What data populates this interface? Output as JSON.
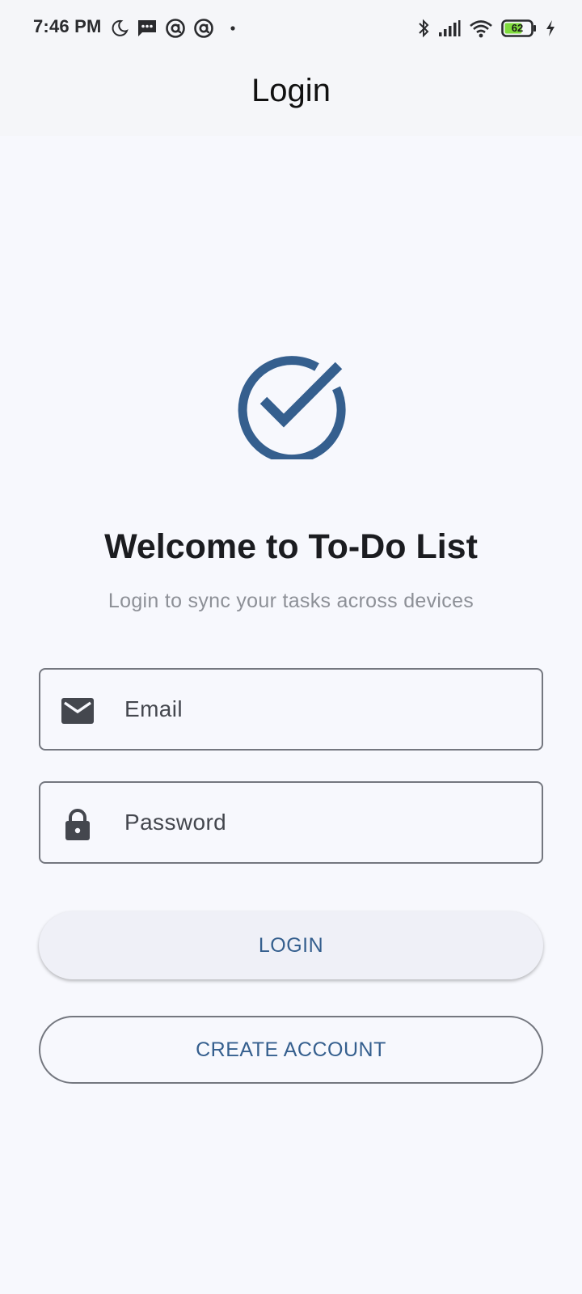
{
  "status_bar": {
    "time": "7:46 PM",
    "battery_level": "62",
    "left_icons": [
      "moon-icon",
      "message-icon",
      "at-sign-icon",
      "at-sign-icon",
      "dot-icon"
    ],
    "right_icons": [
      "bluetooth-icon",
      "signal-icon",
      "wifi-icon",
      "battery-icon",
      "charging-icon"
    ]
  },
  "app_bar": {
    "title": "Login"
  },
  "welcome": {
    "logo_icon": "check-circle-icon",
    "title": "Welcome to To-Do List",
    "subtitle": "Login to sync your tasks across devices"
  },
  "form": {
    "email": {
      "icon": "email-icon",
      "placeholder": "Email",
      "value": ""
    },
    "password": {
      "icon": "lock-icon",
      "placeholder": "Password",
      "value": ""
    },
    "login_label": "LOGIN",
    "create_account_label": "CREATE ACCOUNT"
  },
  "colors": {
    "accent": "#355f8e",
    "background": "#f7f8fd",
    "outline": "#74777f"
  }
}
